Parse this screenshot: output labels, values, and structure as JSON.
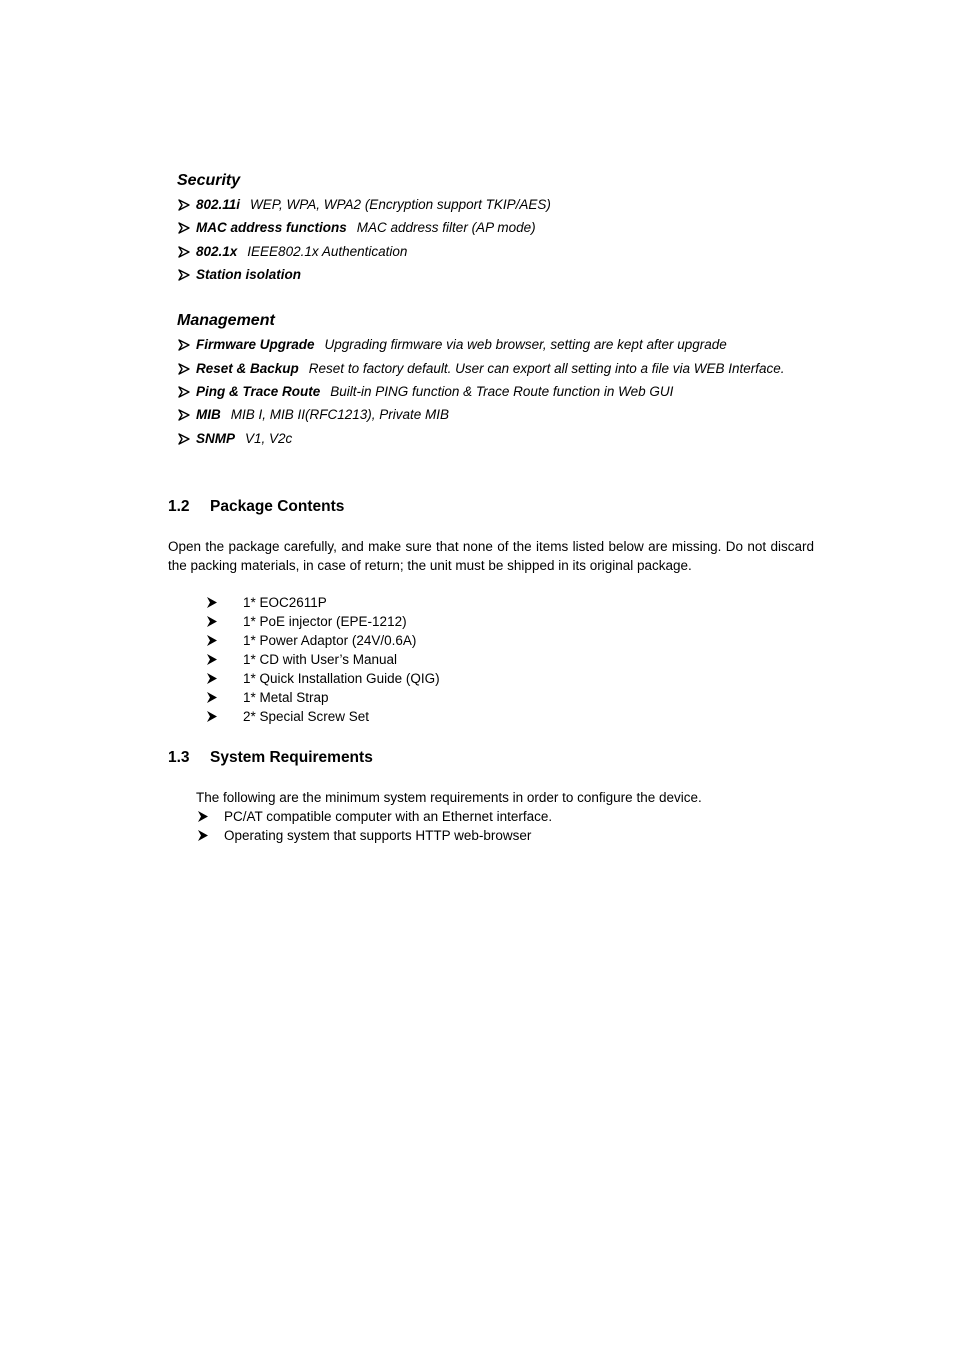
{
  "security": {
    "heading": "Security",
    "items": [
      {
        "term": "802.11i",
        "desc": "WEP, WPA, WPA2 (Encryption support TKIP/AES)"
      },
      {
        "term": "MAC address functions",
        "desc": "MAC address filter (AP mode)"
      },
      {
        "term": "802.1x",
        "desc": "IEEE802.1x Authentication"
      },
      {
        "term": "Station isolation",
        "desc": ""
      }
    ]
  },
  "management": {
    "heading": "Management",
    "items": [
      {
        "term": "Firmware Upgrade",
        "desc": "Upgrading firmware via web browser, setting are kept after upgrade"
      },
      {
        "term": "Reset & Backup",
        "desc": "Reset to factory default. User can export all setting into a file via WEB Interface."
      },
      {
        "term": "Ping & Trace Route",
        "desc": "Built-in PING function & Trace Route function in Web GUI"
      },
      {
        "term": "MIB",
        "desc": "MIB I, MIB II(RFC1213), Private MIB"
      },
      {
        "term": "SNMP",
        "desc": "V1, V2c"
      }
    ]
  },
  "package_contents": {
    "number": "1.2",
    "title": "Package Contents",
    "intro": "Open the package carefully, and make sure that none of the items listed below are missing. Do not discard the packing materials, in case of return; the unit must be shipped in its original package.",
    "items": [
      "1* EOC2611P",
      "1* PoE injector (EPE-1212)",
      "1* Power Adaptor (24V/0.6A)",
      "1* CD with User’s Manual",
      "1* Quick Installation Guide (QIG)",
      "1* Metal Strap",
      "2* Special Screw Set"
    ]
  },
  "system_requirements": {
    "number": "1.3",
    "title": "System Requirements",
    "intro": "The following are the minimum system requirements in order to configure the device.",
    "items": [
      "PC/AT compatible computer with an Ethernet interface.",
      "Operating system that supports HTTP web-browser"
    ]
  }
}
